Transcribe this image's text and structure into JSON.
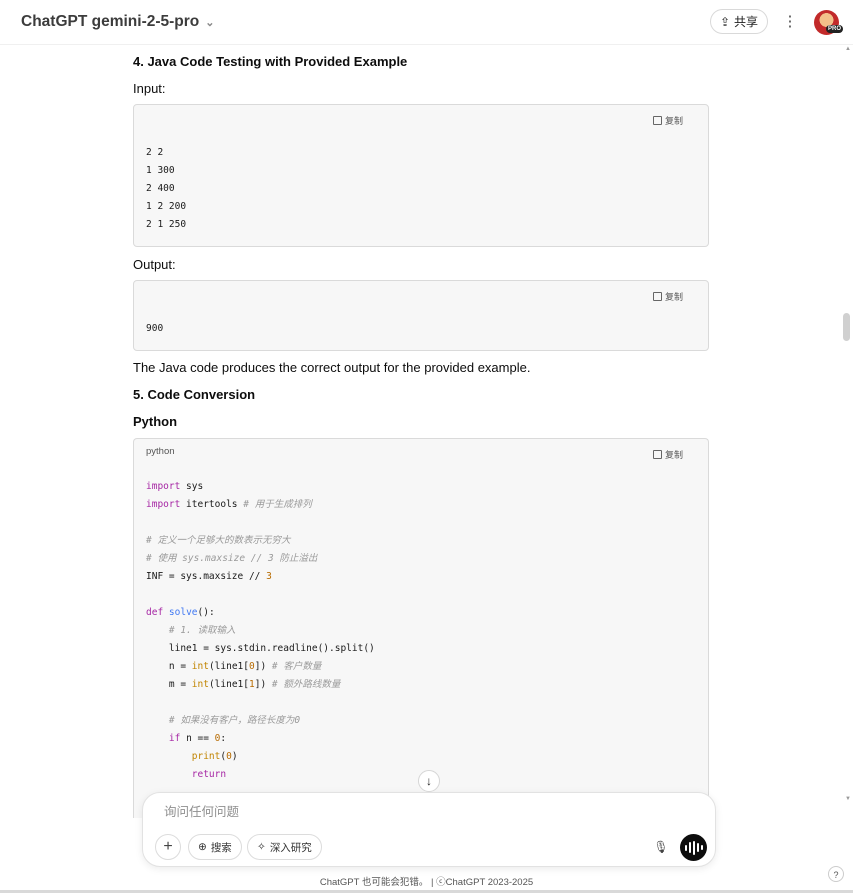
{
  "header": {
    "title": "ChatGPT gemini-2-5-pro",
    "share_label": "共享",
    "pro_badge": "PRO"
  },
  "article": {
    "h_test": "4. Java Code Testing with Provided Example",
    "input_label": "Input:",
    "input_code": "2 2\n1 300\n2 400\n1 2 200\n2 1 250",
    "output_label": "Output:",
    "output_code": "900",
    "copy_label": "复制",
    "result_text": "The Java code produces the correct output for the provided example.",
    "h_conv": "5. Code Conversion",
    "h_python": "Python",
    "python_lang": "python"
  },
  "composer": {
    "placeholder": "询问任何问题",
    "search_label": "搜索",
    "research_label": "深入研究"
  },
  "footer": {
    "text": "ChatGPT 也可能会犯错。 | ⓒChatGPT 2023-2025"
  },
  "icons": {
    "dropdown": "chevron-down-icon",
    "share": "upload-icon",
    "more": "vertical-dots-icon",
    "copy": "copy-icon",
    "plus": "plus-icon",
    "globe": "globe-icon",
    "telescope": "telescope-icon",
    "mic": "microphone-icon",
    "voice": "voice-mode-icon",
    "scroll_down": "arrow-down-icon",
    "help": "question-icon"
  }
}
